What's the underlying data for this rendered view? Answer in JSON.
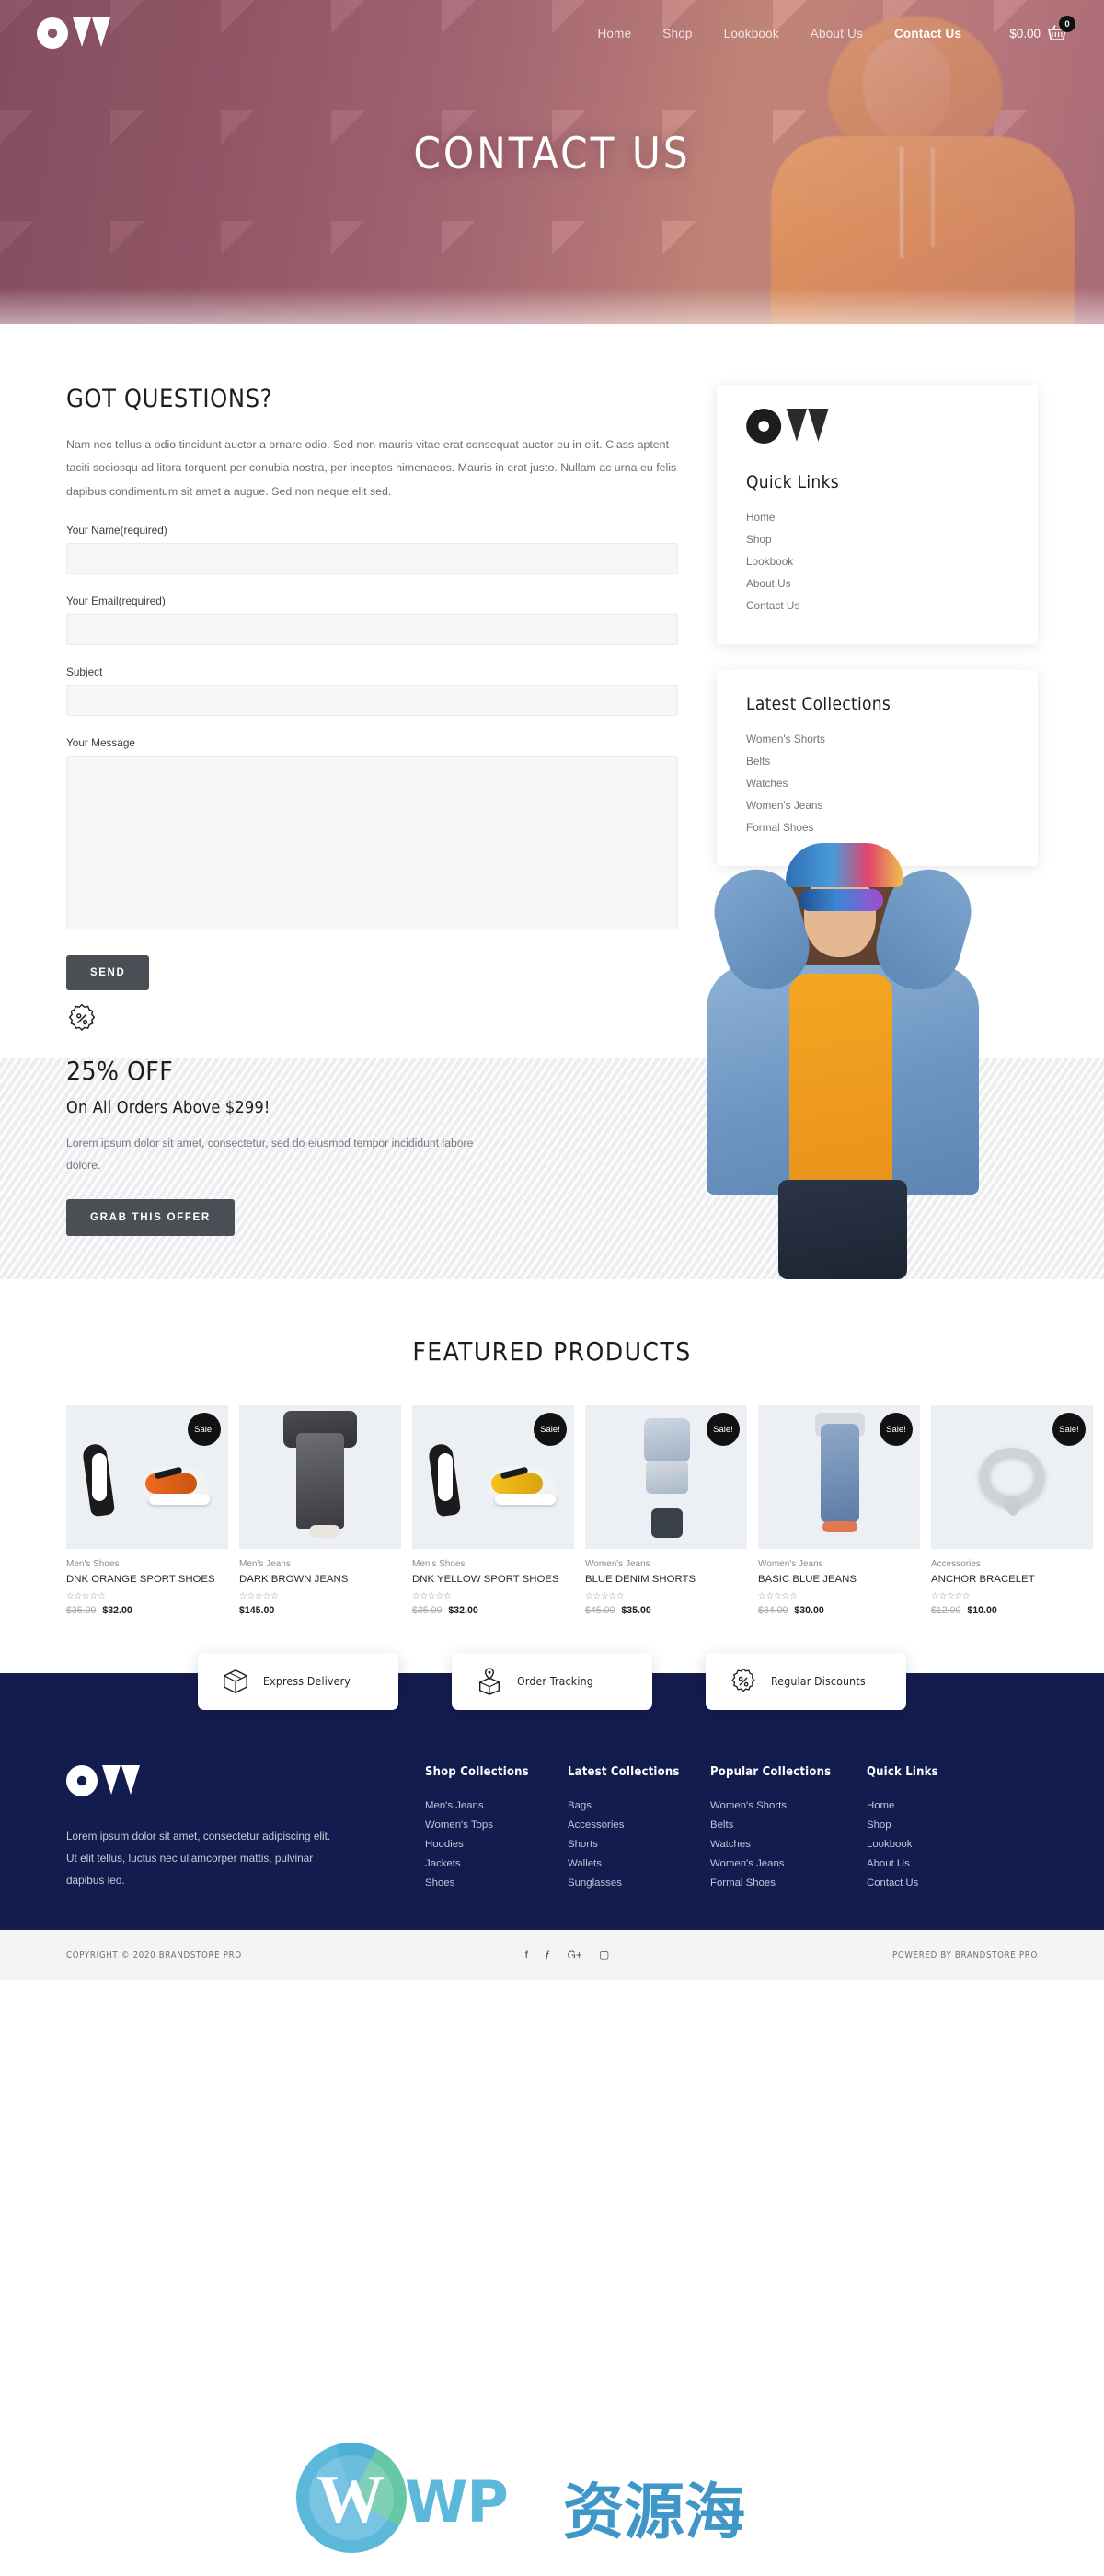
{
  "brand": {
    "name": "BrandStore Pro",
    "logo_icon": "ow-monogram-logo"
  },
  "nav": {
    "items": [
      {
        "label": "Home",
        "active": false
      },
      {
        "label": "Shop",
        "active": false
      },
      {
        "label": "Lookbook",
        "active": false
      },
      {
        "label": "About Us",
        "active": false
      },
      {
        "label": "Contact Us",
        "active": true
      }
    ],
    "cart": {
      "amount": "$0.00",
      "count": "0",
      "icon": "shopping-basket-icon"
    }
  },
  "hero": {
    "title": "CONTACT US"
  },
  "contact": {
    "heading": "GOT QUESTIONS?",
    "body": "Nam nec tellus a odio tincidunt auctor a ornare odio. Sed non mauris vitae erat consequat auctor eu in elit. Class aptent taciti sociosqu ad litora torquent per conubia nostra, per inceptos himenaeos. Mauris in erat justo. Nullam ac urna eu felis dapibus condimentum sit amet a augue. Sed non neque elit sed.",
    "fields": [
      {
        "label": "Your Name(required)",
        "value": "",
        "placeholder": ""
      },
      {
        "label": "Your Email(required)",
        "value": "",
        "placeholder": ""
      },
      {
        "label": "Subject",
        "value": "",
        "placeholder": ""
      }
    ],
    "message_label": "Your Message",
    "message_value": "",
    "submit_label": "SEND"
  },
  "sidebar": {
    "quick_links": {
      "title": "Quick Links",
      "items": [
        "Home",
        "Shop",
        "Lookbook",
        "About Us",
        "Contact Us"
      ]
    },
    "latest_collections": {
      "title": "Latest Collections",
      "items": [
        "Women's Shorts",
        "Belts",
        "Watches",
        "Women's Jeans",
        "Formal Shoes"
      ]
    }
  },
  "promo": {
    "badge_icon": "discount-seal-icon",
    "headline": "25% OFF",
    "subheadline": "On All Orders Above $299!",
    "body": "Lorem ipsum dolor sit amet, consectetur, sed do eiusmod tempor incididunt labore dolore.",
    "cta_label": "GRAB THIS OFFER"
  },
  "featured": {
    "title": "FEATURED PRODUCTS",
    "sale_badge": "Sale!",
    "products": [
      {
        "category": "Men's Shoes",
        "name": "DNK ORANGE SPORT SHOES",
        "rating": 0,
        "old_price": "$35.00",
        "price": "$32.00",
        "on_sale": true,
        "art": "sneaker"
      },
      {
        "category": "Men's Jeans",
        "name": "DARK BROWN JEANS",
        "rating": 0,
        "old_price": "",
        "price": "$145.00",
        "on_sale": false,
        "art": "jeansart"
      },
      {
        "category": "Men's Shoes",
        "name": "DNK YELLOW SPORT SHOES",
        "rating": 0,
        "old_price": "$35.00",
        "price": "$32.00",
        "on_sale": true,
        "art": "sneaker"
      },
      {
        "category": "Women's Jeans",
        "name": "BLUE DENIM SHORTS",
        "rating": 0,
        "old_price": "$45.00",
        "price": "$35.00",
        "on_sale": true,
        "art": "shorts"
      },
      {
        "category": "Women's Jeans",
        "name": "BASIC BLUE JEANS",
        "rating": 0,
        "old_price": "$34.00",
        "price": "$30.00",
        "on_sale": true,
        "art": "bluejeans"
      },
      {
        "category": "Accessories",
        "name": "ANCHOR BRACELET",
        "rating": 0,
        "old_price": "$12.00",
        "price": "$10.00",
        "on_sale": true,
        "art": "bracelet"
      }
    ]
  },
  "services": [
    {
      "label": "Express Delivery",
      "icon": "package-box-icon"
    },
    {
      "label": "Order Tracking",
      "icon": "package-location-pin-icon"
    },
    {
      "label": "Regular Discounts",
      "icon": "discount-seal-icon"
    }
  ],
  "footer": {
    "about": "Lorem ipsum dolor sit amet, consectetur adipiscing elit. Ut elit tellus, luctus nec ullamcorper mattis, pulvinar dapibus leo.",
    "columns": [
      {
        "title": "Shop Collections",
        "items": [
          "Men's Jeans",
          "Women's Tops",
          "Hoodies",
          "Jackets",
          "Shoes"
        ]
      },
      {
        "title": "Latest Collections",
        "items": [
          "Bags",
          "Accessories",
          "Shorts",
          "Wallets",
          "Sunglasses"
        ]
      },
      {
        "title": "Popular Collections",
        "items": [
          "Women's Shorts",
          "Belts",
          "Watches",
          "Women's Jeans",
          "Formal Shoes"
        ]
      },
      {
        "title": "Quick Links",
        "items": [
          "Home",
          "Shop",
          "Lookbook",
          "About Us",
          "Contact Us"
        ]
      }
    ],
    "copyright": "COPYRIGHT © 2020 BRANDSTORE PRO",
    "powered_by": "POWERED BY BRANDSTORE PRO",
    "socials": [
      {
        "name": "facebook-icon",
        "glyph": "f"
      },
      {
        "name": "twitter-icon",
        "glyph": "ƒ"
      },
      {
        "name": "googleplus-icon",
        "glyph": "G+"
      },
      {
        "name": "instagram-icon",
        "glyph": "▢"
      }
    ]
  },
  "watermark": {
    "text": "WP",
    "text_cn": "资源海"
  },
  "colors": {
    "navy": "#131c4e",
    "button": "#4a4f55",
    "hero_rose": "#a9697a",
    "accent_orange": "#e8931a"
  }
}
